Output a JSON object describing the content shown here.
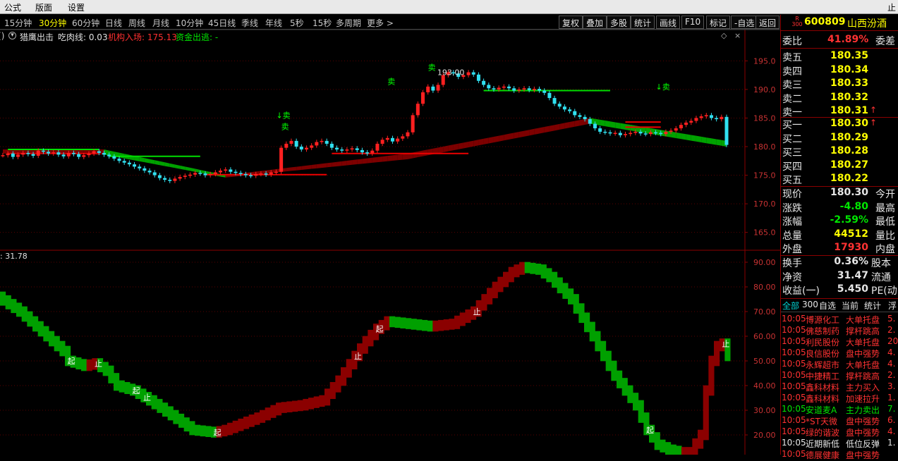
{
  "menu": [
    "公式",
    "版面",
    "设置",
    "止"
  ],
  "periods": [
    "15分钟",
    "30分钟",
    "60分钟",
    "日线",
    "周线",
    "月线",
    "10分钟",
    "45日线",
    "季线",
    "年线",
    "5秒",
    "15秒",
    "多周期",
    "更多 >"
  ],
  "active_period": "30分钟",
  "toolbar": [
    "复权",
    "叠加",
    "多股",
    "统计",
    "画线",
    "F10",
    "标记",
    "-自选",
    "返回"
  ],
  "indicator_bar": {
    "circle_label": "2",
    "name": "猎鹰出击",
    "eat_label": "吃肉线: 0.03",
    "inst_label": "机构入场: 175.13",
    "fund_label": "资金出逃: -"
  },
  "sub_value": ": 31.78",
  "stock": {
    "code": "600809",
    "name": "山西汾酒",
    "badge_top": "R",
    "badge_bottom": "300"
  },
  "weibi": {
    "label": "委比",
    "value": "41.89%",
    "diff_label": "委差"
  },
  "asks": [
    {
      "label": "卖五",
      "price": "180.35"
    },
    {
      "label": "卖四",
      "price": "180.34"
    },
    {
      "label": "卖三",
      "price": "180.33"
    },
    {
      "label": "卖二",
      "price": "180.32"
    },
    {
      "label": "卖一",
      "price": "180.31",
      "arrow": "↑"
    }
  ],
  "bids": [
    {
      "label": "买一",
      "price": "180.30",
      "arrow": "↑"
    },
    {
      "label": "买二",
      "price": "180.29"
    },
    {
      "label": "买三",
      "price": "180.28"
    },
    {
      "label": "买四",
      "price": "180.27"
    },
    {
      "label": "买五",
      "price": "180.22"
    }
  ],
  "quote": [
    {
      "l": "现价",
      "v": "180.30",
      "r": "今开",
      "c": "wht"
    },
    {
      "l": "涨跌",
      "v": "-4.80",
      "r": "最高",
      "c": "grn"
    },
    {
      "l": "涨幅",
      "v": "-2.59%",
      "r": "最低",
      "c": "grn"
    },
    {
      "l": "总量",
      "v": "44512",
      "r": "量比",
      "c": "yel"
    },
    {
      "l": "外盘",
      "v": "17930",
      "r": "内盘",
      "c": "red"
    }
  ],
  "quote2": [
    {
      "l": "换手",
      "v": "0.36%",
      "r": "股本"
    },
    {
      "l": "净资",
      "v": "31.47",
      "r": "流通"
    },
    {
      "l": "收益(一)",
      "v": "5.450",
      "r": "PE(动)"
    }
  ],
  "ticker_tabs": [
    "全部",
    "300",
    "自选",
    "当前",
    "统计",
    "浮"
  ],
  "ticker": [
    {
      "t": "10:05",
      "s": "博源化工",
      "e": "大单托盘",
      "n": "5.",
      "c": "red"
    },
    {
      "t": "10:05",
      "s": "佛慈制药",
      "e": "撑杆跳高",
      "n": "2.",
      "c": "red"
    },
    {
      "t": "10:05",
      "s": "利民股份",
      "e": "大单托盘",
      "n": "20",
      "c": "red"
    },
    {
      "t": "10:05",
      "s": "良信股份",
      "e": "盘中强势",
      "n": "4.",
      "c": "red"
    },
    {
      "t": "10:05",
      "s": "永辉超市",
      "e": "大单托盘",
      "n": "4.",
      "c": "red"
    },
    {
      "t": "10:05",
      "s": "中捷精工",
      "e": "撑杆跳高",
      "n": "2.",
      "c": "red"
    },
    {
      "t": "10:05",
      "s": "鑫科材料",
      "e": "主力买入",
      "n": "3.",
      "c": "red"
    },
    {
      "t": "10:05",
      "s": "鑫科材料",
      "e": "加速拉升",
      "n": "1.",
      "c": "red"
    },
    {
      "t": "10:05",
      "s": "安道麦A",
      "e": "主力卖出",
      "n": "7.",
      "c": "grn"
    },
    {
      "t": "10:05",
      "s": "*ST天微",
      "e": "盘中强势",
      "n": "6.",
      "c": "red"
    },
    {
      "t": "10:05",
      "s": "绿的谐波",
      "e": "盘中强势",
      "n": "4.",
      "c": "red"
    },
    {
      "t": "10:05",
      "s": "近期新低",
      "e": "低位反弹",
      "n": "1.",
      "c": "wht"
    },
    {
      "t": "10:05",
      "s": "德展健康",
      "e": "盘中强势",
      "n": "",
      "c": "red"
    }
  ],
  "chart_data": [
    {
      "type": "candlestick",
      "title": "猎鹰出击",
      "yticks": [
        "195.0",
        "190.0",
        "185.0",
        "180.0",
        "175.0",
        "170.0",
        "165.0"
      ],
      "ylim": [
        162,
        198
      ],
      "closes": [
        178.5,
        178.8,
        178.2,
        178.6,
        178.9,
        178.7,
        178.4,
        179.3,
        179.1,
        178.8,
        179.0,
        178.6,
        178.3,
        178.9,
        178.7,
        178.2,
        178.5,
        178.8,
        179.2,
        178.9,
        178.6,
        178.3,
        177.9,
        177.5,
        177.2,
        176.9,
        176.5,
        176.2,
        175.8,
        175.5,
        175.0,
        174.5,
        174.2,
        174.0,
        174.4,
        174.7,
        174.9,
        175.1,
        175.4,
        175.3,
        175.0,
        175.2,
        175.5,
        175.8,
        176.0,
        175.6,
        175.4,
        175.2,
        175.0,
        174.9,
        175.2,
        175.3,
        175.1,
        175.5,
        175.6,
        179.8,
        180.5,
        181.0,
        180.0,
        179.5,
        179.8,
        180.2,
        180.8,
        181.0,
        180.5,
        179.8,
        179.5,
        179.3,
        179.5,
        179.7,
        179.4,
        179.0,
        178.8,
        179.3,
        180.5,
        181.2,
        181.5,
        180.9,
        181.4,
        181.8,
        182.5,
        185.5,
        187.5,
        189.5,
        190.5,
        189.8,
        190.8,
        192.5,
        193.0,
        192.8,
        192.2,
        192.5,
        193.0,
        192.6,
        191.5,
        190.8,
        190.2,
        190.0,
        190.3,
        190.5,
        190.2,
        189.8,
        190.0,
        190.2,
        189.9,
        190.1,
        189.8,
        189.4,
        188.5,
        187.5,
        187.0,
        186.5,
        186.2,
        185.5,
        185.2,
        184.8,
        184.0,
        183.2,
        182.6,
        182.5,
        182.3,
        182.4,
        182.0,
        182.2,
        182.4,
        182.6,
        182.3,
        182.2,
        182.5,
        182.4,
        182.2,
        182.6,
        182.8,
        183.2,
        183.8,
        184.2,
        184.5,
        185.0,
        185.3,
        185.5,
        185.0,
        184.8,
        185.2,
        180.3
      ],
      "buy_line": [
        [
          0,
          179.5
        ],
        [
          20,
          179.5
        ],
        [
          44,
          175.0
        ],
        [
          80,
          178.8
        ],
        [
          116,
          185.0
        ],
        [
          143,
          181.0
        ]
      ],
      "sell_line": [
        [
          0,
          178.8
        ],
        [
          20,
          178.6
        ],
        [
          44,
          174.6
        ],
        [
          80,
          177.8
        ],
        [
          116,
          184.0
        ],
        [
          143,
          180.0
        ]
      ],
      "hlines": [
        {
          "from": 1,
          "to": 19,
          "y": 178.8,
          "color": "#d00000"
        },
        {
          "from": 1,
          "to": 19,
          "y": 179.5,
          "color": "#00dd00"
        },
        {
          "from": 21,
          "to": 39,
          "y": 178.3,
          "color": "#00dd00"
        },
        {
          "from": 40,
          "to": 64,
          "y": 175.1,
          "color": "#ee0000"
        },
        {
          "from": 65,
          "to": 92,
          "y": 178.8,
          "color": "#ee0000"
        },
        {
          "from": 95,
          "to": 120,
          "y": 189.8,
          "color": "#00dd00"
        },
        {
          "from": 123,
          "to": 130,
          "y": 183.4,
          "color": "#ee0000"
        },
        {
          "from": 123,
          "to": 130,
          "y": 184.3,
          "color": "#ee0000"
        }
      ],
      "marks": [
        {
          "i": 54,
          "y": 185.0,
          "text": "↓卖",
          "color": "#00ff00"
        },
        {
          "i": 55,
          "y": 183.0,
          "text": "卖",
          "color": "#00ff00"
        },
        {
          "i": 76,
          "y": 190.9,
          "text": "卖",
          "color": "#00ff00"
        },
        {
          "i": 84,
          "y": 193.4,
          "text": "卖",
          "color": "#00ff00"
        },
        {
          "i": 129,
          "y": 190.0,
          "text": "↓卖",
          "color": "#00ff00"
        }
      ],
      "price_note": {
        "i": 85,
        "y": 193.0,
        "text": "193.00"
      }
    },
    {
      "type": "band",
      "yticks": [
        "90.00",
        "80.00",
        "70.00",
        "60.00",
        "50.00",
        "40.00",
        "30.00",
        "20.00"
      ],
      "ylim": [
        12,
        94
      ],
      "x": [
        0,
        4,
        8,
        12,
        13,
        16,
        18,
        20,
        22,
        25,
        28,
        32,
        36,
        40,
        42,
        48,
        52,
        56,
        60,
        63,
        66,
        68,
        70,
        72,
        76,
        80,
        84,
        88,
        92,
        95,
        97,
        100,
        102,
        106,
        110,
        114,
        118,
        120,
        122,
        124,
        126,
        128,
        130,
        131,
        132,
        133,
        134,
        135
      ],
      "y": [
        76,
        70,
        62,
        54,
        50,
        48,
        49,
        46,
        40,
        38,
        34,
        28,
        22,
        21,
        22,
        27,
        31,
        32,
        34,
        42,
        52,
        58,
        63,
        66,
        65,
        64,
        65,
        70,
        80,
        86,
        88,
        87,
        84,
        75,
        60,
        44,
        32,
        22,
        16,
        14,
        13,
        13,
        20,
        38,
        50,
        56,
        57,
        52
      ],
      "band_height": 4.2,
      "labels": [
        {
          "i": 13,
          "text": "起",
          "dy": 0
        },
        {
          "i": 18,
          "text": "止",
          "dy": 0
        },
        {
          "i": 25,
          "text": "起",
          "dy": 0
        },
        {
          "i": 27,
          "text": "止",
          "dy": 0
        },
        {
          "i": 40,
          "text": "起",
          "dy": 0
        },
        {
          "i": 66,
          "text": "止",
          "dy": 0
        },
        {
          "i": 70,
          "text": "起",
          "dy": 0
        },
        {
          "i": 88,
          "text": "止",
          "dy": 0
        },
        {
          "i": 120,
          "text": "起",
          "dy": 0
        },
        {
          "i": 134,
          "text": "止",
          "dy": 0
        }
      ]
    }
  ]
}
